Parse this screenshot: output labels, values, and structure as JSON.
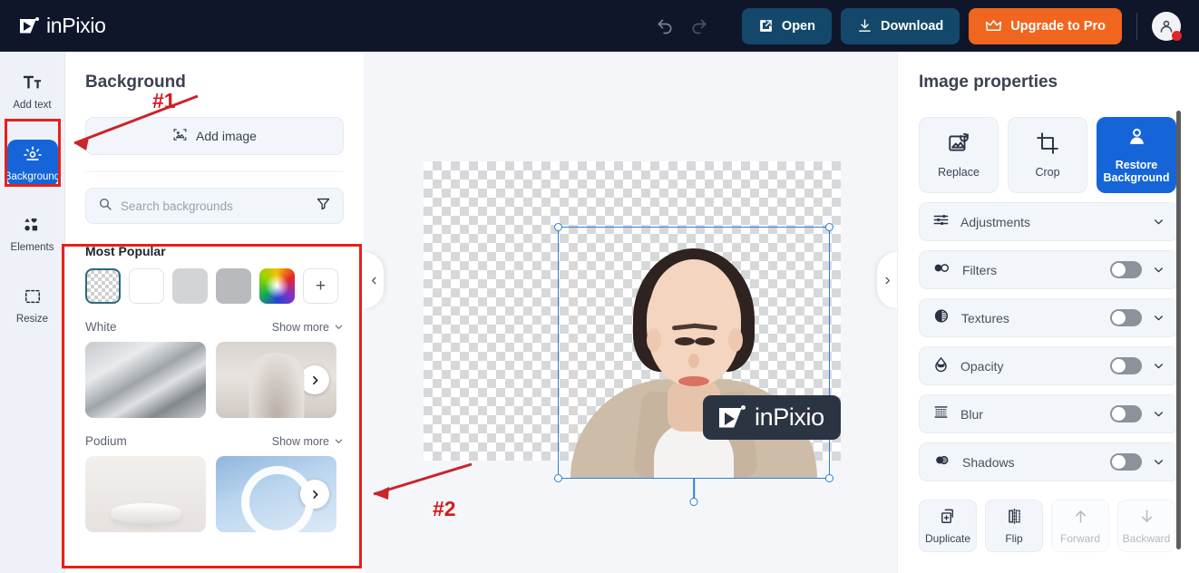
{
  "app": {
    "brand": "inPixio"
  },
  "header": {
    "undo_icon": "undo-icon",
    "redo_icon": "redo-icon",
    "open_label": "Open",
    "download_label": "Download",
    "upgrade_label": "Upgrade to Pro",
    "avatar_icon": "user-avatar-icon",
    "colors": {
      "bar": "#10162a",
      "dark_button": "#13486b",
      "accent_orange": "#f0661f",
      "badge_red": "#e0242b"
    }
  },
  "rail": {
    "items": [
      {
        "label": "Add text",
        "icon": "text-icon",
        "active": false
      },
      {
        "label": "Background",
        "icon": "background-icon",
        "active": true
      },
      {
        "label": "Elements",
        "icon": "elements-icon",
        "active": false
      },
      {
        "label": "Resize",
        "icon": "resize-icon",
        "active": false
      }
    ],
    "active_color": "#1565d8"
  },
  "panel": {
    "title": "Background",
    "add_image_label": "Add image",
    "add_image_icon": "add-image-icon",
    "search": {
      "placeholder": "Search backgrounds",
      "value": "",
      "search_icon": "search-icon",
      "filter_icon": "filter-icon"
    },
    "most_popular": {
      "title": "Most Popular",
      "swatches": [
        {
          "name": "transparent",
          "selected": true
        },
        {
          "name": "white",
          "color": "#ffffff"
        },
        {
          "name": "light-grey",
          "color": "#d3d4d6"
        },
        {
          "name": "grey",
          "color": "#b8babd"
        },
        {
          "name": "color-picker"
        },
        {
          "name": "add-custom",
          "label": "+"
        }
      ]
    },
    "categories": [
      {
        "name": "White",
        "show_more_label": "Show more",
        "thumbs": [
          "white-landscape-thumb",
          "white-arches-thumb"
        ]
      },
      {
        "name": "Podium",
        "show_more_label": "Show more",
        "thumbs": [
          "podium-neutral-thumb",
          "podium-blue-thumb"
        ]
      }
    ]
  },
  "canvas": {
    "left_collapse_icon": "chevron-left-icon",
    "right_collapse_icon": "chevron-right-icon",
    "watermark_text": "inPixio",
    "selection": {
      "handles": 4,
      "rotate_handle": true
    }
  },
  "properties": {
    "title": "Image properties",
    "actions": [
      {
        "label": "Replace",
        "icon": "replace-image-icon",
        "primary": false
      },
      {
        "label": "Crop",
        "icon": "crop-icon",
        "primary": false
      },
      {
        "label": "Restore Background",
        "icon": "restore-background-icon",
        "primary": true
      }
    ],
    "rows": [
      {
        "label": "Adjustments",
        "icon": "adjustments-icon",
        "toggle": false,
        "toggle_on": false
      },
      {
        "label": "Filters",
        "icon": "filters-icon",
        "toggle": true,
        "toggle_on": false
      },
      {
        "label": "Textures",
        "icon": "textures-icon",
        "toggle": true,
        "toggle_on": false
      },
      {
        "label": "Opacity",
        "icon": "opacity-icon",
        "toggle": true,
        "toggle_on": false
      },
      {
        "label": "Blur",
        "icon": "blur-icon",
        "toggle": true,
        "toggle_on": false
      },
      {
        "label": "Shadows",
        "icon": "shadows-icon",
        "toggle": true,
        "toggle_on": false
      }
    ],
    "footer": [
      {
        "label": "Duplicate",
        "icon": "duplicate-icon",
        "enabled": true
      },
      {
        "label": "Flip",
        "icon": "flip-icon",
        "enabled": true
      },
      {
        "label": "Forward",
        "icon": "arrow-up-icon",
        "enabled": false
      },
      {
        "label": "Backward",
        "icon": "arrow-down-icon",
        "enabled": false
      }
    ],
    "primary_color": "#1565d8"
  },
  "annotations": {
    "marker_1": "#1",
    "marker_2": "#2",
    "color": "#e8201b"
  }
}
